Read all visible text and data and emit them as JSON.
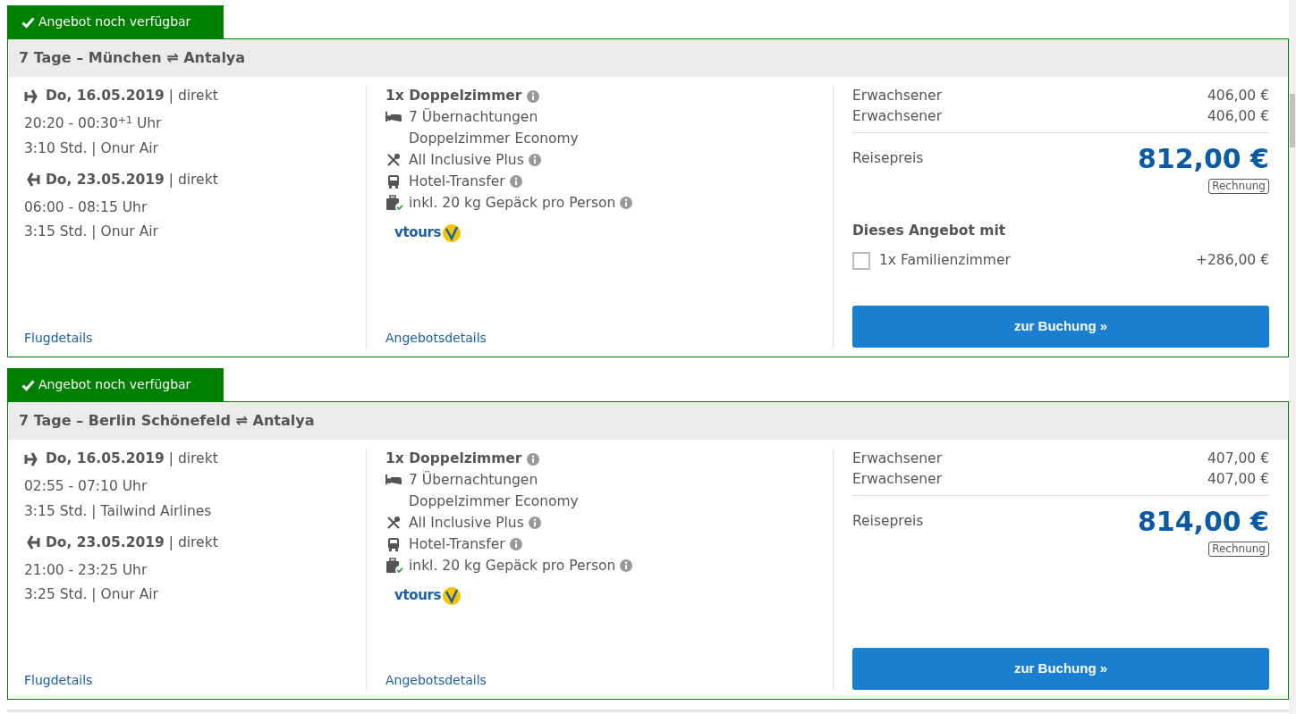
{
  "offers": [
    {
      "badge": "Angebot noch verfügbar",
      "title": "7 Tage – München ⇌ Antalya",
      "flights": [
        {
          "kind": "outbound",
          "heading": "**Do, 16.05.2019** | direkt",
          "times": "20:20 - 00:30$^{+1}$ Uhr",
          "info": "3:10 Std. | Onur Air"
        },
        {
          "kind": "return",
          "heading": "**Do, 23.05.2019** | direkt",
          "times": "06:00 - 08:15 Uhr",
          "info": "3:15 Std. | Onur Air"
        }
      ],
      "flight_link": "Flugdetails",
      "room": "1x Doppelzimmer",
      "features": [
        {
          "kind": "bed",
          "text": "7 Übernachtungen",
          "info": false
        },
        {
          "kind": "none",
          "text": "Doppelzimmer Economy",
          "info": false
        },
        {
          "kind": "meal",
          "text": "All Inclusive Plus",
          "info": true
        },
        {
          "kind": "bus",
          "text": "Hotel-Transfer",
          "info": true
        },
        {
          "kind": "luggage",
          "text": "inkl. 20 kg Gepäck pro Person",
          "info": true
        }
      ],
      "logo": "vtours",
      "offer_link": "Angebotsdetails",
      "prices": [
        {
          "label": "Erwachsener",
          "amount": "406,00 €"
        },
        {
          "label": "Erwachsener",
          "amount": "406,00 €"
        }
      ],
      "total_label": "Reisepreis",
      "total": "812,00 €",
      "invoice": "Rechnung",
      "extras": {
        "title": "Dieses Angebot mit",
        "items": [
          {
            "label": "1x Familienzimmer",
            "amount": "+286,00 €",
            "checked": false
          }
        ]
      },
      "button": "zur Buchung »"
    },
    {
      "badge": "Angebot noch verfügbar",
      "title": "7 Tage – Berlin Schönefeld ⇌ Antalya",
      "flights": [
        {
          "kind": "outbound",
          "heading": "**Do, 16.05.2019** | direkt",
          "times": "02:55 - 07:10 Uhr",
          "info": "3:15 Std. | Tailwind Airlines"
        },
        {
          "kind": "return",
          "heading": "**Do, 23.05.2019** | direkt",
          "times": "21:00 - 23:25 Uhr",
          "info": "3:25 Std. | Onur Air"
        }
      ],
      "flight_link": "Flugdetails",
      "room": "1x Doppelzimmer",
      "features": [
        {
          "kind": "bed",
          "text": "7 Übernachtungen",
          "info": false
        },
        {
          "kind": "none",
          "text": "Doppelzimmer Economy",
          "info": false
        },
        {
          "kind": "meal",
          "text": "All Inclusive Plus",
          "info": true
        },
        {
          "kind": "bus",
          "text": "Hotel-Transfer",
          "info": true
        },
        {
          "kind": "luggage",
          "text": "inkl. 20 kg Gepäck pro Person",
          "info": true
        }
      ],
      "logo": "vtours",
      "offer_link": "Angebotsdetails",
      "prices": [
        {
          "label": "Erwachsener",
          "amount": "407,00 €"
        },
        {
          "label": "Erwachsener",
          "amount": "407,00 €"
        }
      ],
      "total_label": "Reisepreis",
      "total": "814,00 €",
      "invoice": "Rechnung",
      "button": "zur Buchung »"
    }
  ]
}
